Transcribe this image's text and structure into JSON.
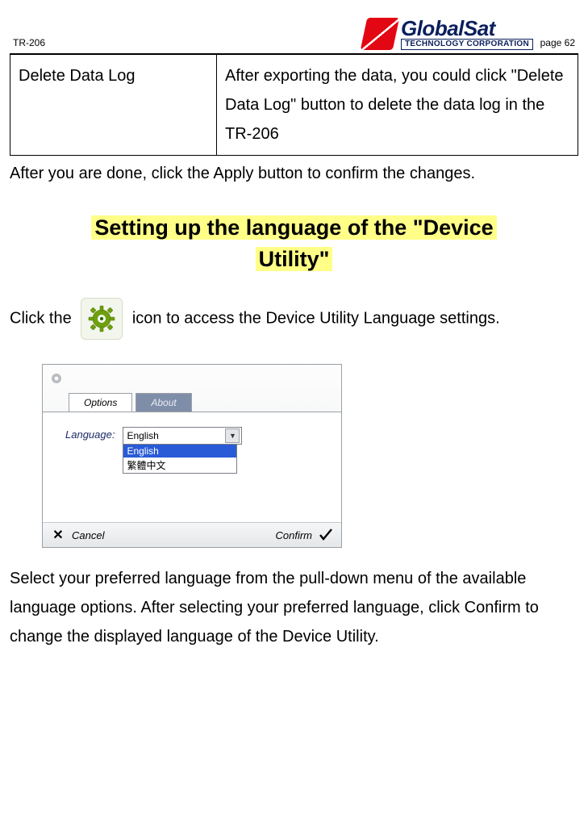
{
  "header": {
    "doc_id": "TR-206",
    "page_label": "page 62",
    "brand_name": "GlobalSat",
    "brand_sub": "TECHNOLOGY CORPORATION"
  },
  "table": {
    "left": "Delete Data Log",
    "right": "After exporting the data, you could click  \"Delete Data Log\" button to delete the data log in the TR-206"
  },
  "para_after_table": "After you are done, click the Apply button to confirm the changes.",
  "section_title_1": "Setting up the language of the \"Device",
  "section_title_2": "Utility\"",
  "click_the": "Click the",
  "click_rest": "icon to access the Device Utility Language settings.",
  "dialog": {
    "tab_options": "Options",
    "tab_about": "About",
    "lang_label": "Language:",
    "combo_value": "English",
    "options": [
      "English",
      "繁體中文"
    ],
    "cancel": "Cancel",
    "confirm": "Confirm"
  },
  "para_bottom": "Select your preferred language from the pull-down menu of the available language options. After selecting your preferred language, click Confirm to change the displayed language of the Device Utility."
}
